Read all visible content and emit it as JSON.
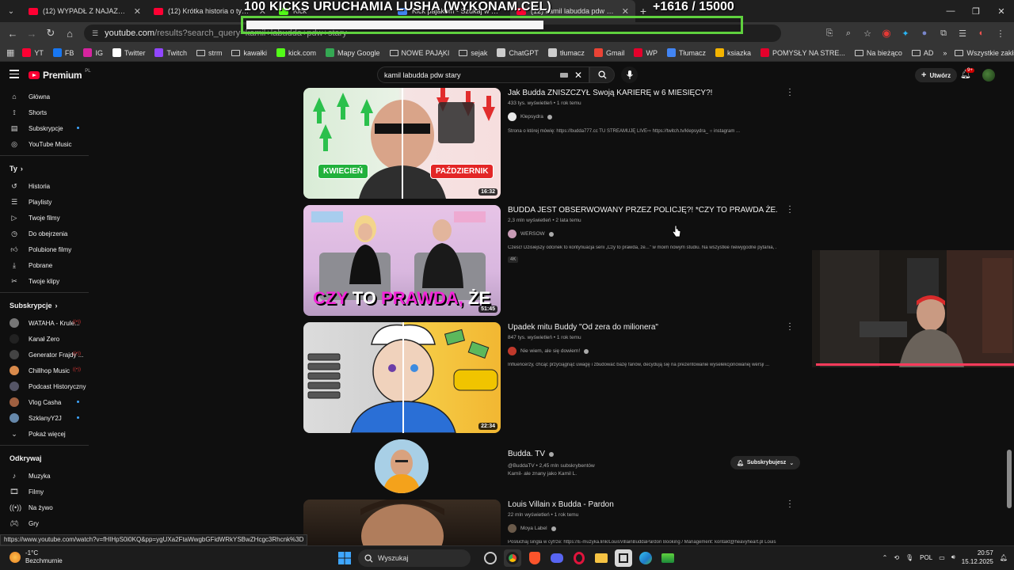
{
  "browser": {
    "tabs": [
      {
        "label": "(12) WYPADŁ Z NAJAZDU | Pie"
      },
      {
        "label": "(12) Krótka historia o tym, że"
      },
      {
        "label": "Kick"
      },
      {
        "label": "Kick pajakom - Szukaj w Googl"
      },
      {
        "label": "(12) kamil labudda pdw stary -"
      }
    ],
    "url_main": "youtube.com",
    "url_path": "/results?search_query=kamil+labudda+pdw+stary",
    "status_url": "https://www.youtube.com/watch?v=fHIHpS0i0KQ&pp=ygUXa2FtaWwgbGFidWRkYSBwZHcgc3Rhcnk%3D"
  },
  "bookmarks": [
    {
      "label": "YT",
      "color": "#ff0033"
    },
    {
      "label": "FB",
      "color": "#1877f2"
    },
    {
      "label": "IG",
      "color": "#d6249f"
    },
    {
      "label": "Twitter",
      "color": "#ffffff"
    },
    {
      "label": "Twitch",
      "color": "#9146ff"
    },
    {
      "label": "strm",
      "folder": true
    },
    {
      "label": "kawałki",
      "folder": true
    },
    {
      "label": "kick.com",
      "color": "#53fc18"
    },
    {
      "label": "Mapy Google",
      "color": "#34a853"
    },
    {
      "label": "NOWE PAJĄKI",
      "folder": true
    },
    {
      "label": "sejak",
      "folder": true
    },
    {
      "label": "ChatGPT",
      "color": "#cccccc"
    },
    {
      "label": "tłumacz",
      "color": "#cccccc"
    },
    {
      "label": "Gmail",
      "color": "#ea4335"
    },
    {
      "label": "WP",
      "color": "#e4002b"
    },
    {
      "label": "Tłumacz",
      "color": "#4285f4"
    },
    {
      "label": "ksiazka",
      "color": "#f4b400"
    },
    {
      "label": "POMYSŁY NA STRE...",
      "color": "#e4002b"
    },
    {
      "label": "Na bieżąco",
      "folder": true
    },
    {
      "label": "AD",
      "folder": true
    }
  ],
  "bookmarks_all": "Wszystkie zakładki",
  "overlay": {
    "title": "100 KICKS URUCHAMIA LUSHA (WYKONAM.CEL)",
    "count": "+1616   / 15000",
    "progress": 0.108
  },
  "yt": {
    "logo": "Premium",
    "logo_region": "PL",
    "search_value": "kamil labudda pdw stary",
    "create_label": "Utwórz",
    "notif_count": "9+",
    "sidebar": {
      "main": [
        {
          "label": "Główna",
          "icon": "home-icon"
        },
        {
          "label": "Shorts",
          "icon": "shorts-icon"
        },
        {
          "label": "Subskrypcje",
          "icon": "subscriptions-icon"
        },
        {
          "label": "YouTube Music",
          "icon": "music-icon"
        }
      ],
      "you_title": "Ty",
      "you": [
        {
          "label": "Historia"
        },
        {
          "label": "Playlisty"
        },
        {
          "label": "Twoje filmy"
        },
        {
          "label": "Do obejrzenia"
        },
        {
          "label": "Polubione filmy"
        },
        {
          "label": "Pobrane"
        },
        {
          "label": "Twoje klipy"
        }
      ],
      "subs_title": "Subskrypcje",
      "subs": [
        {
          "label": "WATAHA - Krule...",
          "color": "#777"
        },
        {
          "label": "Kanał Zero",
          "color": "#222"
        },
        {
          "label": "Generator Frajdy ...",
          "color": "#444"
        },
        {
          "label": "Chillhop Music",
          "color": "#d98a4b"
        },
        {
          "label": "Podcast Historyczny",
          "color": "#556"
        },
        {
          "label": "Vlog Casha",
          "color": "#a06040"
        },
        {
          "label": "SzklanyY2J",
          "color": "#6688aa"
        }
      ],
      "show_more": "Pokaż więcej",
      "explore_title": "Odkrywaj",
      "explore": [
        {
          "label": "Muzyka"
        },
        {
          "label": "Filmy"
        },
        {
          "label": "Na żywo"
        },
        {
          "label": "Gry"
        }
      ]
    },
    "results": [
      {
        "title": "Jak Budda ZNISZCZYŁ Swoją KARIERĘ w 6 MIESIĘCY?!",
        "meta": "433 tys. wyświetleń • 1 rok temu",
        "channel": "Klepsydra",
        "desc": "Strona o której mówię: https://budda777.cc TU STREAMUJĘ LIVE⇨ https://twitch.tv/klepsydra_ ○ instagram ...",
        "duration": "16:32",
        "thumb_left": "KWIECIEŃ",
        "thumb_right": "PAŹDZIERNIK"
      },
      {
        "title": "BUDDA JEST OBSERWOWANY PRZEZ POLICJĘ?! *CZY TO PRAWDA ŻE...*",
        "meta": "2,3 mln wyświetleń • 2 lata temu",
        "channel": "WERSOW",
        "desc": "Cześć! Dzisiejszy odcinek to kontynuacja serii „Czy to prawda, że...\" w moim nowym studiu. Na wszystkie niewygodne pytania, ...",
        "duration": "51:45",
        "badge": "4K",
        "thumb_word1": "CZY",
        "thumb_word2": "TO",
        "thumb_word3": "PRAWDA,",
        "thumb_word4": "ŻE"
      },
      {
        "title": "Upadek mitu Buddy \"Od zera do milionera\"",
        "meta": "847 tys. wyświetleń • 1 rok temu",
        "channel": "Nie wiem, ale się dowiem!",
        "desc": "Influencerzy, chcąc przyciągnąć uwagę i zbudować bazę fanów, decydują się na prezentowanie wyselekcjonowanej wersji ...",
        "duration": "22:34"
      }
    ],
    "channel_card": {
      "name": "Budda. TV",
      "handle": "@BuddaTV • 2,45 mln subskrybentów",
      "desc": "Kamil- ale znany jako Kamil L.",
      "sub_label": "Subskrybujesz"
    },
    "last_result": {
      "title": "Louis Villain x Budda - Pardon",
      "meta": "22 mln wyświetleń • 1 rok temu",
      "channel": "Moya Label",
      "desc": "Posłuchaj singla w cyfrze: https://E-muzyka.link/LouisVillainBuddaPardon Booking / Management: kontakt@heavyheart.pl Louis ..."
    }
  },
  "taskbar": {
    "temp": "-1°C",
    "weather": "Bezchmurnie",
    "search": "Wyszukaj",
    "lang": "POL",
    "time": "20:57",
    "date": "15.12.2025"
  }
}
